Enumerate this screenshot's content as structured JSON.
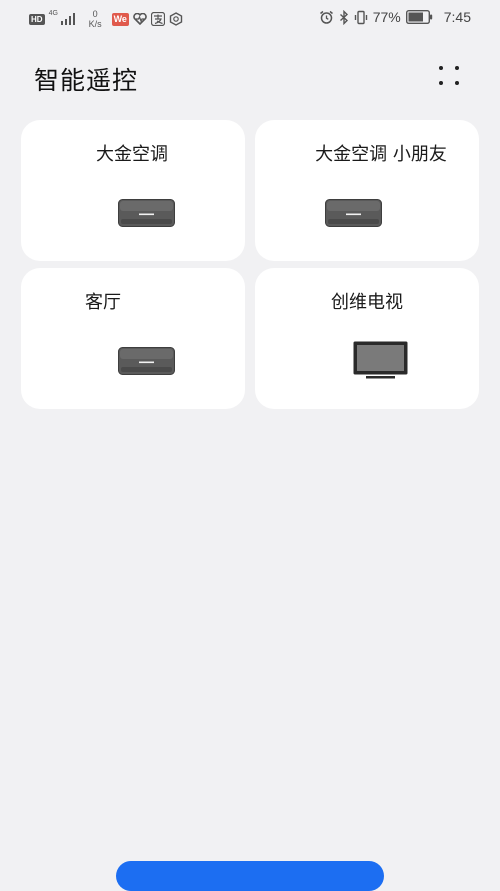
{
  "status_bar": {
    "hd": "HD",
    "network": "4G",
    "net_speed_value": "0",
    "net_speed_unit": "K/s",
    "app_badge": "We",
    "battery_percent": "77%",
    "time": "7:45",
    "icons": [
      "signal-icon",
      "heart-health-icon",
      "alipay-icon",
      "hexagon-app-icon",
      "alarm-icon",
      "bluetooth-icon",
      "vibrate-icon",
      "battery-icon"
    ]
  },
  "header": {
    "title": "智能遥控",
    "more_icon": "more-dots-icon"
  },
  "devices": [
    {
      "name": "大金空调",
      "icon": "air-conditioner-icon"
    },
    {
      "name": "大金空调 小朋友",
      "icon": "air-conditioner-icon"
    },
    {
      "name": "客厅",
      "icon": "air-conditioner-icon"
    },
    {
      "name": "创维电视",
      "icon": "tv-icon"
    }
  ],
  "colors": {
    "background": "#f1f1f3",
    "card": "#ffffff",
    "accent": "#1c6ef2"
  }
}
